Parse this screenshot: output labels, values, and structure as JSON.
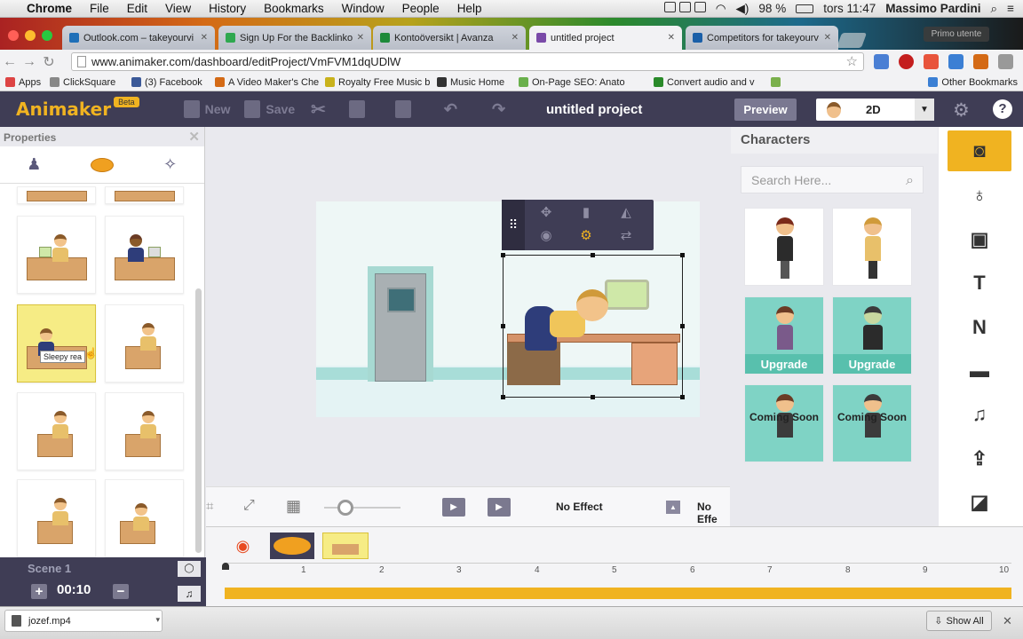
{
  "menubar": {
    "app": "Chrome",
    "items": [
      "File",
      "Edit",
      "View",
      "History",
      "Bookmarks",
      "Window",
      "People",
      "Help"
    ],
    "battery": "98 %",
    "clock": "tors 11:47",
    "user": "Massimo Pardini"
  },
  "tabs": [
    {
      "title": "Outlook.com – takeyourvi",
      "color": "#1e6fb8"
    },
    {
      "title": "Sign Up For the Backlinko",
      "color": "#2fa84f"
    },
    {
      "title": "Kontoöversikt | Avanza",
      "color": "#1d8a3a"
    },
    {
      "title": "untitled project",
      "color": "#7a4aa8"
    },
    {
      "title": "Competitors for takeyourv",
      "color": "#1a5fa8"
    }
  ],
  "profile": "Primo utente",
  "address": "www.animaker.com/dashboard/editProject/VmFVM1dqUDlW",
  "bookmarks": [
    {
      "label": "Apps",
      "color": "#d44"
    },
    {
      "label": "ClickSquare",
      "color": "#888"
    },
    {
      "label": "(3) Facebook",
      "color": "#3b5998"
    },
    {
      "label": "A Video Maker's Che",
      "color": "#d46a16"
    },
    {
      "label": "Royalty Free Music b",
      "color": "#c9b21c"
    },
    {
      "label": "Music Home",
      "color": "#333"
    },
    {
      "label": "On-Page SEO: Anato",
      "color": "#6ab04c"
    },
    {
      "label": "Convert audio and v",
      "color": "#2a8a2a"
    },
    {
      "label": "Other Bookmarks",
      "color": "#3b7fd4"
    }
  ],
  "header": {
    "logo": "Animaker",
    "beta": "Beta",
    "new": "New",
    "save": "Save",
    "project_title": "untitled project",
    "preview": "Preview",
    "mode": "2D"
  },
  "properties": {
    "title": "Properties",
    "tooltip": "Sleepy rea"
  },
  "controls": {
    "effect_in": "No Effect",
    "effect_out": "No Effe"
  },
  "characters": {
    "title": "Characters",
    "search_placeholder": "Search Here...",
    "upgrade": "Upgrade",
    "coming_soon": "Coming Soon"
  },
  "timeline": {
    "scene": "Scene 1",
    "duration": "00:10",
    "ticks": [
      "1",
      "2",
      "3",
      "4",
      "5",
      "6",
      "7",
      "8",
      "9",
      "10"
    ]
  },
  "downloads": {
    "file": "jozef.mp4",
    "show_all": "Show All"
  }
}
